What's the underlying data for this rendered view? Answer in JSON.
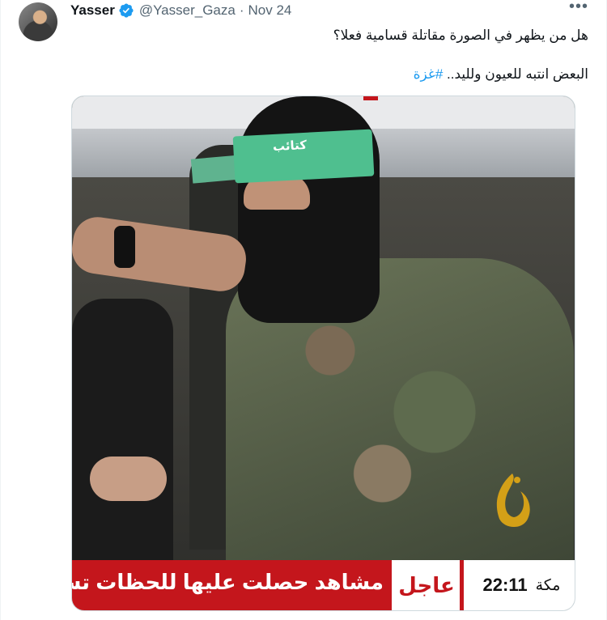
{
  "author": {
    "name": "Yasser",
    "handle": "@Yasser_Gaza",
    "separator": "·",
    "date": "Nov 24",
    "verified_icon": "verified-badge-icon",
    "avatar_icon": "avatar"
  },
  "more_menu": {
    "icon": "more-horizontal-icon",
    "label": "•••"
  },
  "tweet": {
    "line1": "هل من يظهر في الصورة مقاتلة قسامية فعلا؟",
    "line2_text": "البعض انتبه للعيون ولليد.. ",
    "hashtag": "#غزة"
  },
  "media": {
    "headband_text": "كتائب",
    "ticker": {
      "breaking_label": "عاجل",
      "headline": "مشاهد حصلت عليها للحظات تس",
      "time": "22:11",
      "city": "مكة"
    },
    "colors": {
      "accent_red": "#c4161c",
      "headband_green": "#4fbf8f",
      "logo_gold": "#d4a017"
    }
  },
  "colors": {
    "link": "#1d9bf0",
    "secondary_text": "#536471",
    "verified": "#1d9bf0"
  }
}
